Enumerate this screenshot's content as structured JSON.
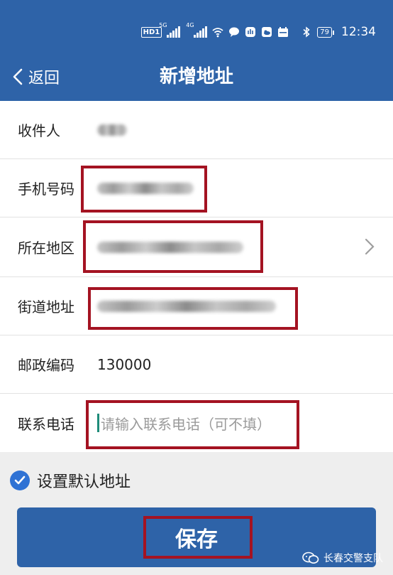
{
  "status_bar": {
    "hd_label": "HD",
    "hd_sub": "1",
    "signal1_tag": "5G",
    "signal2_tag": "4G",
    "battery": "79",
    "time": "12:34"
  },
  "nav": {
    "back_label": "返回",
    "title": "新增地址"
  },
  "form": {
    "recipient_label": "收件人",
    "phone_label": "手机号码",
    "region_label": "所在地区",
    "street_label": "街道地址",
    "postcode_label": "邮政编码",
    "postcode_value": "130000",
    "contact_label": "联系电话",
    "contact_placeholder": "请输入联系电话（可不填）"
  },
  "default_address": {
    "label": "设置默认地址",
    "checked": true
  },
  "save_button": "保存",
  "watermark": "长春交警支队",
  "colors": {
    "brand_blue": "#2e63a8",
    "highlight_red": "#a41322",
    "check_blue": "#2f72d4"
  }
}
